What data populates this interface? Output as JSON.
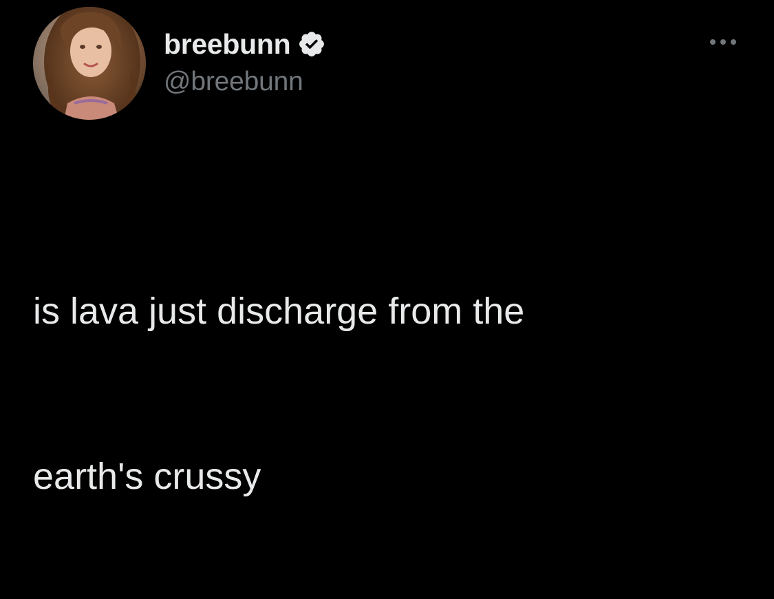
{
  "tweet": {
    "display_name": "breebunn",
    "handle": "@breebunn",
    "verified": true,
    "text_lines": [
      "is lava just discharge from the",
      "earth's crussy"
    ]
  },
  "icons": {
    "verified": "verified-badge-icon",
    "more": "more-options-icon"
  },
  "colors": {
    "background": "#000000",
    "primary_text": "#e7e9ea",
    "secondary_text": "#71767b"
  }
}
